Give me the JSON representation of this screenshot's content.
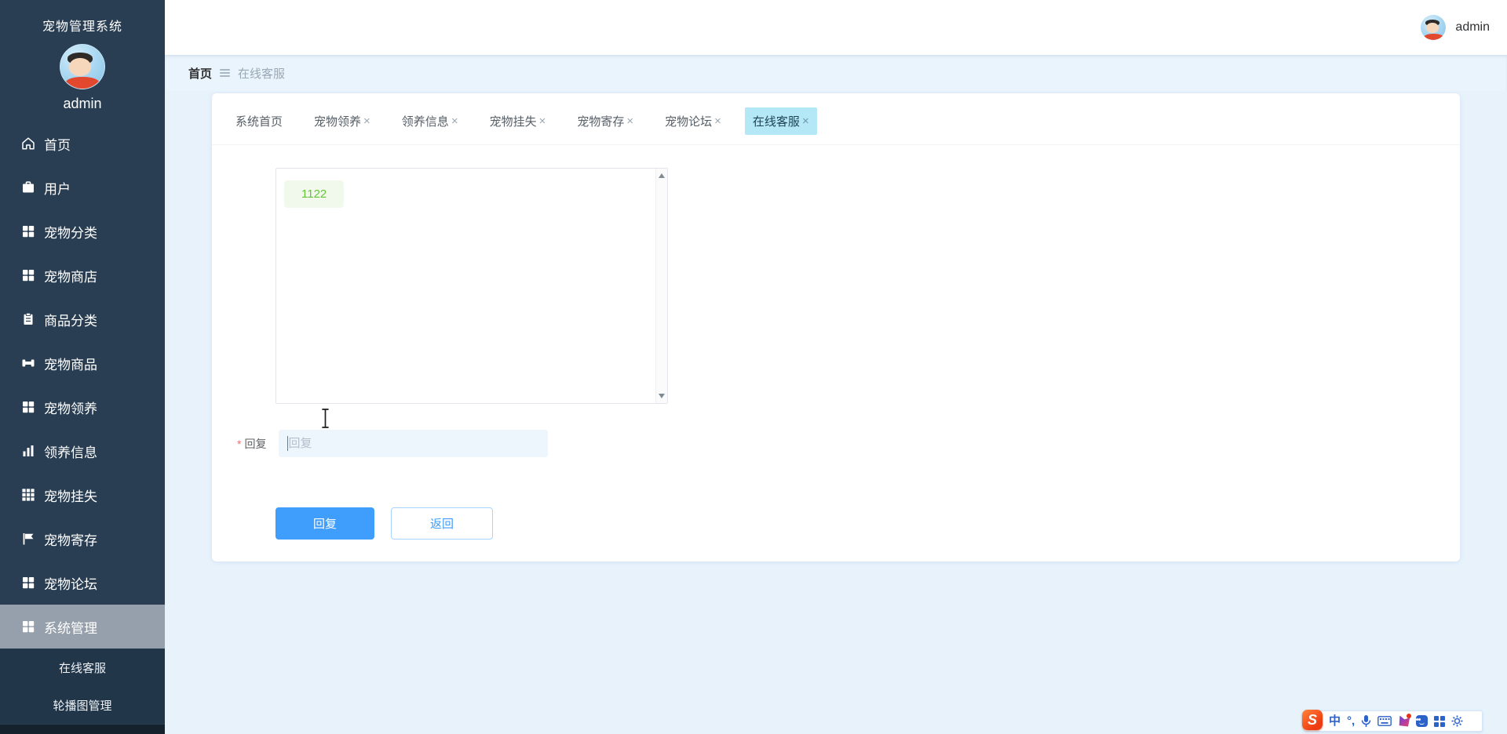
{
  "colors": {
    "sidebar_bg": "#293e52",
    "sidebar_submenu_bg": "#223649",
    "sidebar_selected_bg": "#96a0ac",
    "page_bg": "#e7f2fb",
    "breadcrumb_bg": "#eaf4fc",
    "active_tab_bg": "#b4e8f7",
    "active_tab_text": "#1f4254",
    "bubble_bg": "#f0f9eb",
    "bubble_text": "#67c23a",
    "input_bg": "#edf6fd",
    "primary_button_bg": "#3f9dfb",
    "secondary_button_text": "#3f9dfb",
    "required_mark_color": "#f56c6c",
    "sogou_logo_color": "#ee3b12",
    "ime_icon_color": "#2d62c9"
  },
  "sidebar": {
    "title": "宠物管理系统",
    "username": "admin",
    "items": [
      {
        "label": "首页",
        "icon": "home-icon"
      },
      {
        "label": "用户",
        "icon": "briefcase-icon"
      },
      {
        "label": "宠物分类",
        "icon": "grid-icon"
      },
      {
        "label": "宠物商店",
        "icon": "grid-icon"
      },
      {
        "label": "商品分类",
        "icon": "clipboard-icon"
      },
      {
        "label": "宠物商品",
        "icon": "bone-icon"
      },
      {
        "label": "宠物领养",
        "icon": "grid-icon"
      },
      {
        "label": "领养信息",
        "icon": "bar-chart-icon"
      },
      {
        "label": "宠物挂失",
        "icon": "grid9-icon"
      },
      {
        "label": "宠物寄存",
        "icon": "flag-icon"
      },
      {
        "label": "宠物论坛",
        "icon": "grid-icon"
      },
      {
        "label": "系统管理",
        "icon": "grid-icon",
        "selected": true
      }
    ],
    "submenu": [
      {
        "label": "在线客服"
      },
      {
        "label": "轮播图管理"
      }
    ]
  },
  "header": {
    "username": "admin"
  },
  "breadcrumb": {
    "home": "首页",
    "current": "在线客服"
  },
  "tabs": [
    {
      "label": "系统首页",
      "closable": false,
      "active": false
    },
    {
      "label": "宠物领养",
      "closable": true,
      "active": false
    },
    {
      "label": "领养信息",
      "closable": true,
      "active": false
    },
    {
      "label": "宠物挂失",
      "closable": true,
      "active": false
    },
    {
      "label": "宠物寄存",
      "closable": true,
      "active": false
    },
    {
      "label": "宠物论坛",
      "closable": true,
      "active": false
    },
    {
      "label": "在线客服",
      "closable": true,
      "active": true
    }
  ],
  "chat": {
    "messages": [
      {
        "text": "1122",
        "align": "left"
      }
    ]
  },
  "form": {
    "required_mark": "*",
    "label": "回复",
    "placeholder": "回复",
    "value": ""
  },
  "actions": {
    "reply_label": "回复",
    "back_label": "返回"
  },
  "ui": {
    "close_glyph": "×"
  },
  "ime_toolbar": {
    "chinese_mode_label": "中",
    "punctuation_label": "°,",
    "icons": [
      "sogou-logo-icon",
      "chinese-mode-icon",
      "punctuation-icon",
      "microphone-icon",
      "keyboard-icon",
      "ai-assistant-icon",
      "emoji-icon",
      "apps-grid-icon",
      "settings-icon"
    ]
  }
}
